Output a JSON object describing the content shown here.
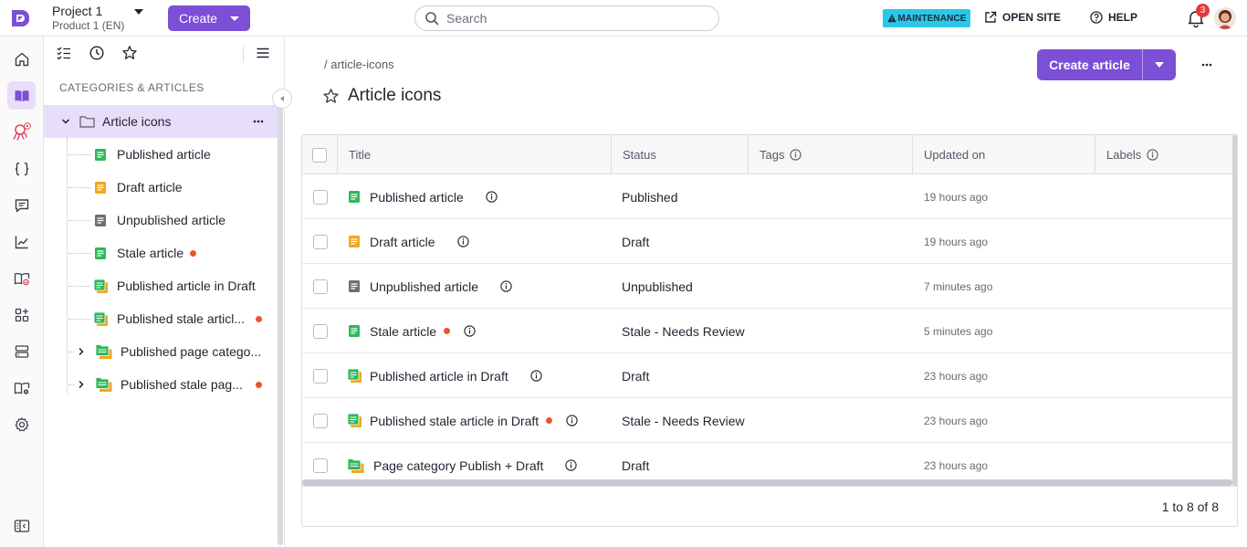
{
  "header": {
    "project_name": "Project 1",
    "product_name": "Product 1 (EN)",
    "create_label": "Create",
    "search_placeholder": "Search",
    "maintenance_label": "MAINTENANCE",
    "open_site_label": "OPEN SITE",
    "help_label": "HELP",
    "notification_count": "3"
  },
  "rail": {
    "items": [
      "home",
      "articles",
      "bot",
      "api-docs",
      "comments",
      "analytics",
      "review",
      "apps",
      "storage",
      "settings-portal",
      "settings",
      "toggle-panel"
    ]
  },
  "sidebar": {
    "heading": "CATEGORIES & ARTICLES",
    "root": "Article icons",
    "items": [
      {
        "label": "Published article",
        "status": "published",
        "stale": false
      },
      {
        "label": "Draft article",
        "status": "draft",
        "stale": false
      },
      {
        "label": "Unpublished article",
        "status": "unpublished",
        "stale": false
      },
      {
        "label": "Stale article",
        "status": "published",
        "stale": true
      },
      {
        "label": "Published article in Draft",
        "status": "published-draft",
        "stale": false
      },
      {
        "label": "Published stale articl...",
        "status": "published-draft",
        "stale": true
      },
      {
        "label": "Published page catego...",
        "status": "category",
        "stale": false
      },
      {
        "label": "Published stale pag...",
        "status": "category",
        "stale": true
      }
    ]
  },
  "main": {
    "breadcrumb": "/ article-icons",
    "title": "Article icons",
    "create_article_label": "Create article",
    "columns": {
      "title": "Title",
      "status": "Status",
      "tags": "Tags",
      "updated": "Updated on",
      "labels": "Labels"
    },
    "rows": [
      {
        "title": "Published article",
        "status": "Published",
        "updated": "19 hours ago",
        "icon": "published",
        "stale": false
      },
      {
        "title": "Draft article",
        "status": "Draft",
        "updated": "19 hours ago",
        "icon": "draft",
        "stale": false
      },
      {
        "title": "Unpublished article",
        "status": "Unpublished",
        "updated": "7 minutes ago",
        "icon": "unpublished",
        "stale": false
      },
      {
        "title": "Stale article",
        "status": "Stale - Needs Review",
        "updated": "5 minutes ago",
        "icon": "published",
        "stale": true
      },
      {
        "title": "Published article in Draft",
        "status": "Draft",
        "updated": "23 hours ago",
        "icon": "published-draft",
        "stale": false
      },
      {
        "title": "Published stale article in Draft",
        "status": "Stale - Needs Review",
        "updated": "23 hours ago",
        "icon": "published-draft",
        "stale": true
      },
      {
        "title": "Page category Publish + Draft",
        "status": "Draft",
        "updated": "23 hours ago",
        "icon": "category",
        "stale": false
      }
    ],
    "pager": "1 to 8 of 8"
  },
  "colors": {
    "accent": "#7b4fd6",
    "published": "#2fb85c",
    "draft": "#f2a81d",
    "unpublished": "#6b6f78",
    "stale": "#f0512e",
    "maintenance": "#2bc6e8"
  }
}
